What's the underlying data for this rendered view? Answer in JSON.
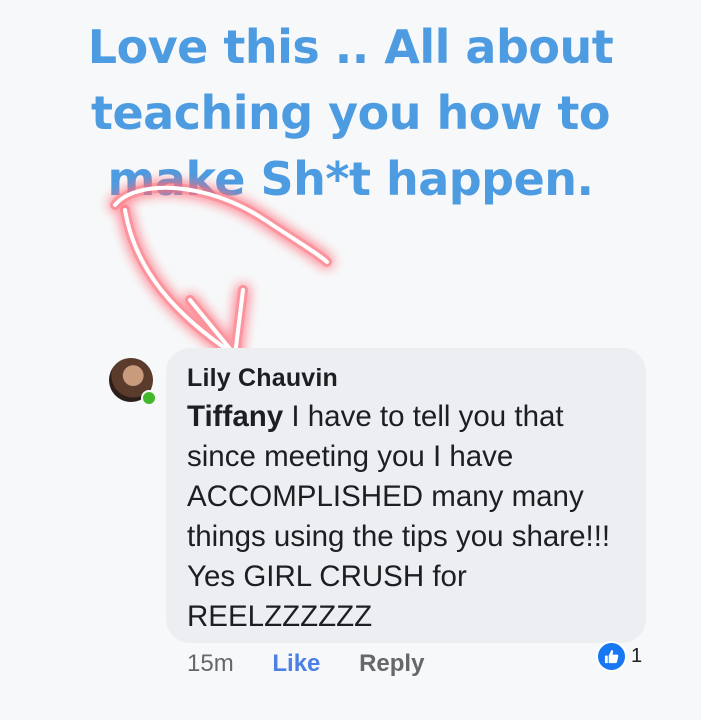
{
  "headline": {
    "line1": "Love this .. All about",
    "line2": "teaching you how to",
    "line3": "make Sh*t happen."
  },
  "comment": {
    "author": "Lily Chauvin",
    "mention": "Tiffany",
    "body": " I have to tell you that since meeting you I have ACCOMPLISHED many many things using the tips you share!!! Yes GIRL CRUSH for REELZZZZZZ"
  },
  "actions": {
    "time": "15m",
    "like_label": "Like",
    "reply_label": "Reply"
  },
  "reactions": {
    "count": "1",
    "icon": "thumbs-up-icon"
  },
  "colors": {
    "headline": "#4d9be0",
    "arrow_glow": "#ff5a6a",
    "bubble": "#eceef1",
    "like_blue": "#1877f2"
  }
}
